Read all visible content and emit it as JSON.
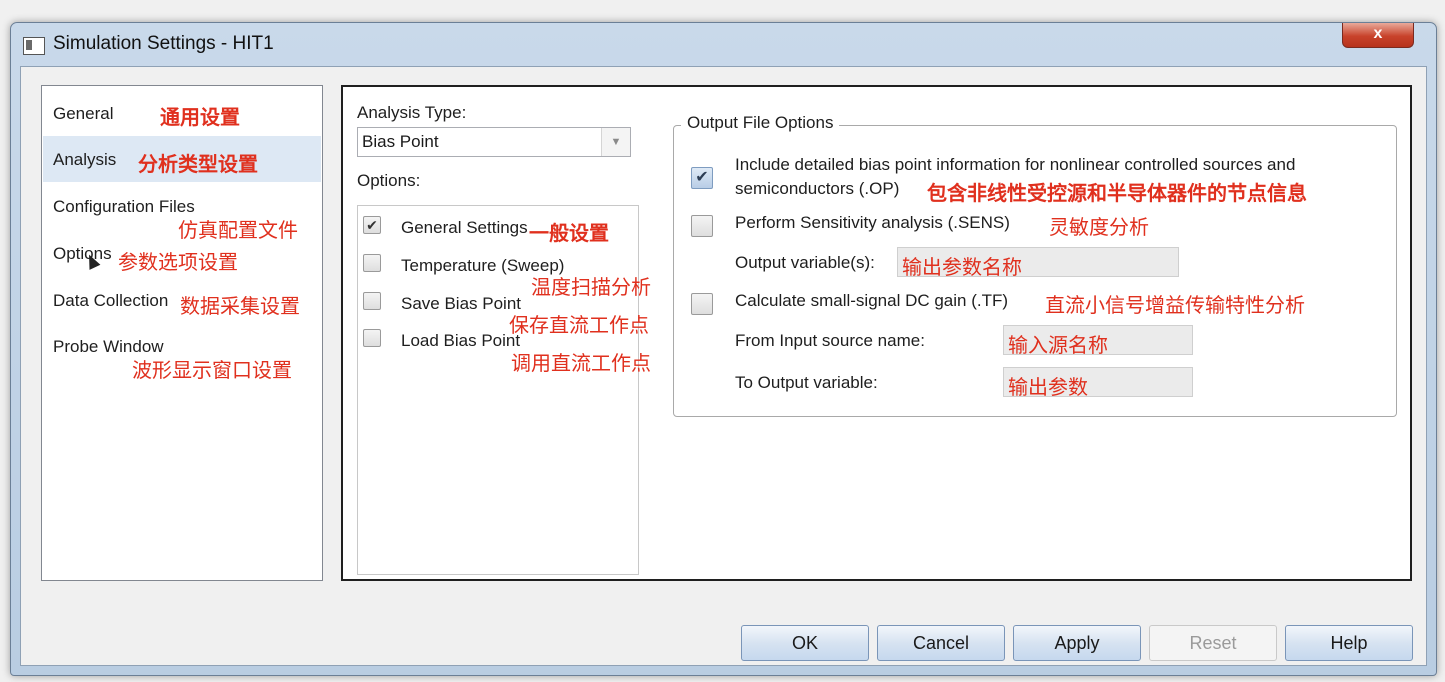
{
  "window": {
    "title": "Simulation Settings - HIT1",
    "close_label": "x"
  },
  "nav": {
    "items": [
      {
        "label": "General",
        "annotation": "通用设置"
      },
      {
        "label": "Analysis",
        "annotation": "分析类型设置"
      },
      {
        "label": "Configuration Files",
        "annotation": "仿真配置文件"
      },
      {
        "label": "Options",
        "annotation": "参数选项设置"
      },
      {
        "label": "Data Collection",
        "annotation": "数据采集设置"
      },
      {
        "label": "Probe Window",
        "annotation": "波形显示窗口设置"
      }
    ],
    "selected": "Analysis"
  },
  "analysis": {
    "type_label": "Analysis Type:",
    "type_value": "Bias Point",
    "options_label": "Options:",
    "options": [
      {
        "label": "General Settings",
        "checked": true,
        "annotation": "一般设置"
      },
      {
        "label": "Temperature (Sweep)",
        "checked": false,
        "annotation": "温度扫描分析"
      },
      {
        "label": "Save Bias Point",
        "checked": false,
        "annotation": "保存直流工作点"
      },
      {
        "label": "Load Bias Point",
        "checked": false,
        "annotation": "调用直流工作点"
      }
    ]
  },
  "output": {
    "legend": "Output File Options",
    "op_line1": "Include detailed bias point information for nonlinear controlled sources and",
    "op_line2": "semiconductors (.OP)",
    "op_annotation": "包含非线性受控源和半导体器件的节点信息",
    "op_checked": true,
    "sens_label": "Perform Sensitivity analysis (.SENS)",
    "sens_annotation": "灵敏度分析",
    "sens_checked": false,
    "output_var_label": "Output variable(s):",
    "output_var_value": "输出参数名称",
    "tf_label": "Calculate small-signal DC gain (.TF)",
    "tf_annotation": "直流小信号增益传输特性分析",
    "tf_checked": false,
    "from_label": "From Input source name:",
    "from_value": "输入源名称",
    "to_label": "To Output variable:",
    "to_value": "输出参数"
  },
  "buttons": {
    "ok": "OK",
    "cancel": "Cancel",
    "apply": "Apply",
    "reset": "Reset",
    "help": "Help"
  },
  "colors": {
    "annotation": "#e0301e",
    "selection": "#dde8f4"
  }
}
